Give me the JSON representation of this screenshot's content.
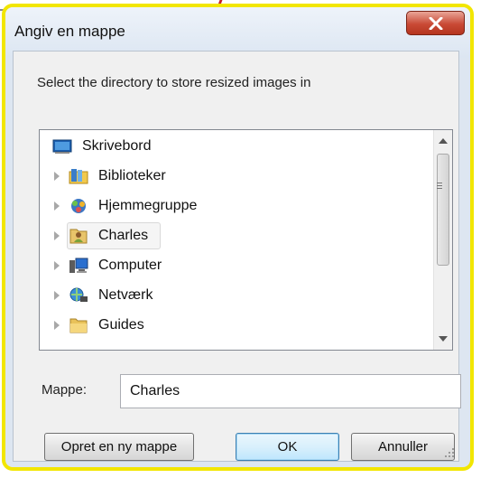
{
  "dialog": {
    "title": "Angiv en mappe",
    "instruction": "Select the directory to store resized images in"
  },
  "tree": {
    "items": [
      {
        "label": "Skrivebord",
        "icon": "desktop-icon",
        "expandable": false,
        "selected": false
      },
      {
        "label": "Biblioteker",
        "icon": "libraries-icon",
        "expandable": true,
        "selected": false
      },
      {
        "label": "Hjemmegruppe",
        "icon": "homegroup-icon",
        "expandable": true,
        "selected": false
      },
      {
        "label": "Charles",
        "icon": "user-folder-icon",
        "expandable": true,
        "selected": true
      },
      {
        "label": "Computer",
        "icon": "computer-icon",
        "expandable": true,
        "selected": false
      },
      {
        "label": "Netværk",
        "icon": "network-icon",
        "expandable": true,
        "selected": false
      },
      {
        "label": "Guides",
        "icon": "folder-icon",
        "expandable": true,
        "selected": false
      }
    ]
  },
  "folder": {
    "label": "Mappe:",
    "value": "Charles"
  },
  "buttons": {
    "new_folder": "Opret en ny mappe",
    "ok": "OK",
    "cancel": "Annuller"
  },
  "colors": {
    "highlight_border": "#f2e600",
    "close_button": "#c94a36"
  }
}
